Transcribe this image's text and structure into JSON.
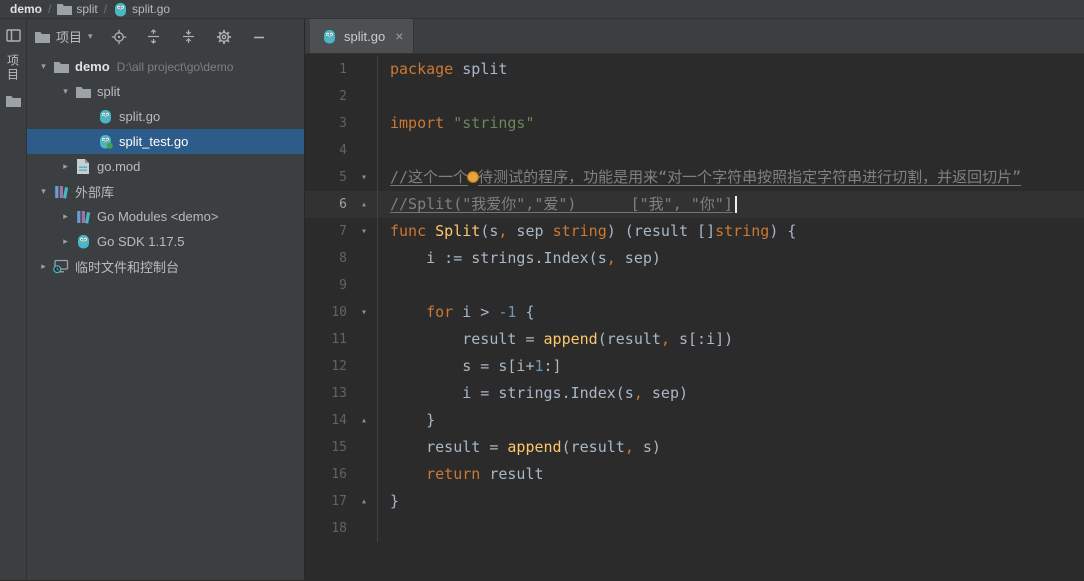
{
  "breadcrumb": {
    "sep": "/",
    "items": [
      {
        "label": "demo"
      },
      {
        "label": "split"
      },
      {
        "label": "split.go"
      }
    ]
  },
  "stripe": {
    "project_label": "项目"
  },
  "project_panel": {
    "toolbar": {
      "selector_label": "项目",
      "caret": "▾"
    }
  },
  "tree": {
    "items": [
      {
        "depth": 0,
        "chevron": "down",
        "icon": "folder",
        "label": "demo",
        "bold": true,
        "suffix": "D:\\all project\\go\\demo"
      },
      {
        "depth": 1,
        "chevron": "down",
        "icon": "folder",
        "label": "split"
      },
      {
        "depth": 2,
        "chevron": "none",
        "icon": "go-file",
        "label": "split.go"
      },
      {
        "depth": 2,
        "chevron": "none",
        "icon": "go-test-file",
        "label": "split_test.go",
        "selected": true
      },
      {
        "depth": 1,
        "chevron": "right",
        "icon": "gomod-file",
        "label": "go.mod"
      },
      {
        "depth": 0,
        "chevron": "down",
        "icon": "library",
        "label": "外部库"
      },
      {
        "depth": 1,
        "chevron": "right",
        "icon": "library",
        "label": "Go Modules <demo>"
      },
      {
        "depth": 1,
        "chevron": "right",
        "icon": "go-file",
        "label": "Go SDK 1.17.5"
      },
      {
        "depth": 0,
        "chevron": "right",
        "icon": "scratches",
        "label": "临时文件和控制台"
      }
    ]
  },
  "editor": {
    "tab": {
      "label": "split.go",
      "close_label": "×"
    },
    "lines": [
      {
        "n": 1,
        "fold": "",
        "segs": [
          {
            "c": "kw",
            "t": "package"
          },
          {
            "c": "pl",
            "t": " split"
          }
        ]
      },
      {
        "n": 2,
        "fold": "",
        "segs": []
      },
      {
        "n": 3,
        "fold": "",
        "segs": [
          {
            "c": "kw",
            "t": "import"
          },
          {
            "c": "pl",
            "t": " "
          },
          {
            "c": "str",
            "t": "\"strings\""
          }
        ]
      },
      {
        "n": 4,
        "fold": "",
        "segs": []
      },
      {
        "n": 5,
        "fold": "down",
        "segs": [
          {
            "c": "com",
            "t": "//这个一个"
          },
          {
            "c": "bulb-icon",
            "t": ""
          },
          {
            "c": "com",
            "t": "待测试的程序，功能是用来“对一个字符串按照指定字符串进行切割，并返回切片”"
          }
        ]
      },
      {
        "n": 6,
        "fold": "up",
        "current": true,
        "segs": [
          {
            "c": "com",
            "t": "//Split(\"我爱你\",\"爱\")      [\"我\", \"你\"]"
          },
          {
            "c": "cursor",
            "t": ""
          }
        ]
      },
      {
        "n": 7,
        "fold": "down",
        "segs": [
          {
            "c": "kw",
            "t": "func "
          },
          {
            "c": "fn",
            "t": "Split"
          },
          {
            "c": "pl",
            "t": "(s"
          },
          {
            "c": "kw",
            "t": ","
          },
          {
            "c": "pl",
            "t": " sep "
          },
          {
            "c": "kw",
            "t": "string"
          },
          {
            "c": "pl",
            "t": ") (result []"
          },
          {
            "c": "kw",
            "t": "string"
          },
          {
            "c": "pl",
            "t": ") {"
          }
        ]
      },
      {
        "n": 8,
        "fold": "",
        "segs": [
          {
            "c": "pl",
            "t": "    i := strings.Index(s"
          },
          {
            "c": "kw",
            "t": ","
          },
          {
            "c": "pl",
            "t": " sep)"
          }
        ]
      },
      {
        "n": 9,
        "fold": "",
        "segs": []
      },
      {
        "n": 10,
        "fold": "down",
        "segs": [
          {
            "c": "pl",
            "t": "    "
          },
          {
            "c": "kw",
            "t": "for"
          },
          {
            "c": "pl",
            "t": " i > "
          },
          {
            "c": "num",
            "t": "-1"
          },
          {
            "c": "pl",
            "t": " {"
          }
        ]
      },
      {
        "n": 11,
        "fold": "",
        "segs": [
          {
            "c": "pl",
            "t": "        result = "
          },
          {
            "c": "fn",
            "t": "append"
          },
          {
            "c": "pl",
            "t": "(result"
          },
          {
            "c": "kw",
            "t": ","
          },
          {
            "c": "pl",
            "t": " s[:i])"
          }
        ]
      },
      {
        "n": 12,
        "fold": "",
        "segs": [
          {
            "c": "pl",
            "t": "        s = s[i+"
          },
          {
            "c": "num",
            "t": "1"
          },
          {
            "c": "pl",
            "t": ":]"
          }
        ]
      },
      {
        "n": 13,
        "fold": "",
        "segs": [
          {
            "c": "pl",
            "t": "        i = strings.Index(s"
          },
          {
            "c": "kw",
            "t": ","
          },
          {
            "c": "pl",
            "t": " sep)"
          }
        ]
      },
      {
        "n": 14,
        "fold": "up",
        "segs": [
          {
            "c": "pl",
            "t": "    }"
          }
        ]
      },
      {
        "n": 15,
        "fold": "",
        "segs": [
          {
            "c": "pl",
            "t": "    result = "
          },
          {
            "c": "fn",
            "t": "append"
          },
          {
            "c": "pl",
            "t": "(result"
          },
          {
            "c": "kw",
            "t": ","
          },
          {
            "c": "pl",
            "t": " s)"
          }
        ]
      },
      {
        "n": 16,
        "fold": "",
        "segs": [
          {
            "c": "pl",
            "t": "    "
          },
          {
            "c": "kw",
            "t": "return"
          },
          {
            "c": "pl",
            "t": " result"
          }
        ]
      },
      {
        "n": 17,
        "fold": "up",
        "segs": [
          {
            "c": "pl",
            "t": "}"
          }
        ]
      },
      {
        "n": 18,
        "fold": "",
        "segs": []
      }
    ]
  },
  "colors": {
    "panel_bg": "#3c3f41",
    "editor_bg": "#2b2b2b",
    "selection_blue": "#2e5c8a",
    "keyword": "#cc7832",
    "string": "#6a8759",
    "comment": "#808080",
    "function": "#ffc66b",
    "number": "#6897bb",
    "plain_text": "#a9b7c6"
  }
}
